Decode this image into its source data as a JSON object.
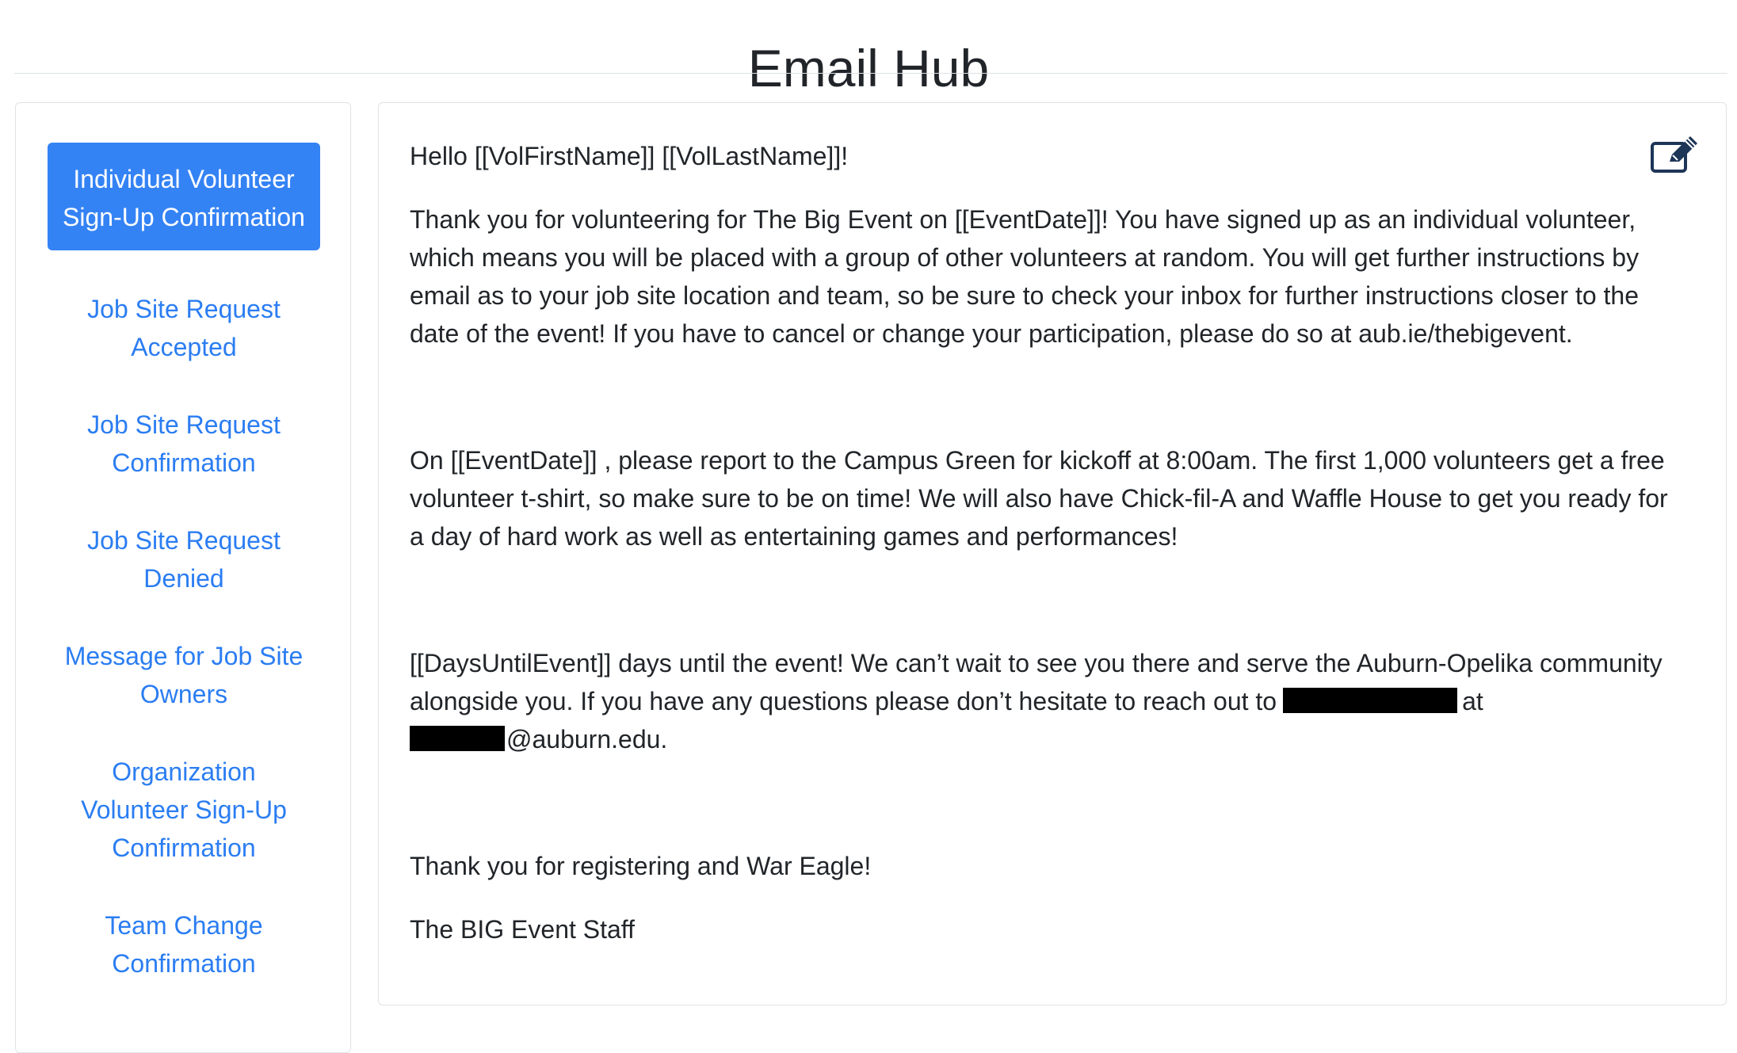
{
  "header": {
    "title": "Email Hub"
  },
  "sidebar": {
    "items": [
      {
        "label": "Individual Volunteer Sign-Up Confirmation",
        "active": true
      },
      {
        "label": "Job Site Request Accepted",
        "active": false
      },
      {
        "label": "Job Site Request Confirmation",
        "active": false
      },
      {
        "label": "Job Site Request Denied",
        "active": false
      },
      {
        "label": "Message for Job Site Owners",
        "active": false
      },
      {
        "label": "Organization Volunteer Sign-Up Confirmation",
        "active": false
      },
      {
        "label": "Team Change Confirmation",
        "active": false
      }
    ]
  },
  "email": {
    "greeting": "Hello [[VolFirstName]] [[VolLastName]]!",
    "paragraph_intro": "Thank you for volunteering for The Big Event on [[EventDate]]! You have signed up as an individual volunteer, which means you will be placed with a group of other volunteers at random. You will get further instructions by email as to your job site location and team, so be sure to check your inbox for further instructions closer to the date of the event! If you have to cancel or change your participation, please do so at aub.ie/thebigevent.",
    "paragraph_kickoff": "On [[EventDate]] , please report to the Campus Green for kickoff at 8:00am. The first 1,000 volunteers get a free volunteer t-shirt, so make sure to be on time! We will also have Chick-fil-A and Waffle House to get you ready for a day of hard work as well as entertaining games and performances!",
    "paragraph_countdown_before": "[[DaysUntilEvent]] days until the event! We can’t wait to see you there and serve the Auburn-Opelika community alongside you. If you have any questions please don’t hesitate to reach out to",
    "paragraph_countdown_at": "at",
    "paragraph_countdown_email_domain": "@auburn.edu.",
    "thanks": "Thank you for registering and War Eagle!",
    "signature": "The BIG Event Staff"
  },
  "icons": {
    "edit": "edit-icon"
  },
  "colors": {
    "link": "#2b7df2",
    "active_background": "#3483f5",
    "active_text": "#ffffff",
    "text": "#212529",
    "border": "#dfe3e7"
  }
}
